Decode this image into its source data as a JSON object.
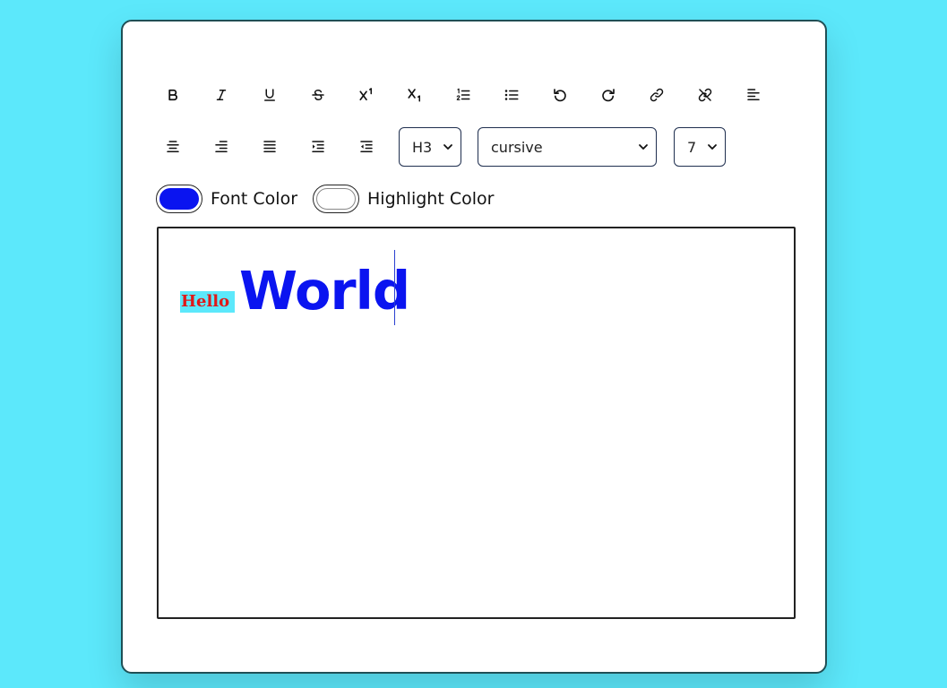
{
  "toolbar": {
    "row1": [
      {
        "name": "bold-button",
        "icon": "bold-icon"
      },
      {
        "name": "italic-button",
        "icon": "italic-icon"
      },
      {
        "name": "underline-button",
        "icon": "underline-icon"
      },
      {
        "name": "strikethrough-button",
        "icon": "strikethrough-icon"
      },
      {
        "name": "superscript-button",
        "icon": "superscript-icon"
      },
      {
        "name": "subscript-button",
        "icon": "subscript-icon"
      },
      {
        "name": "ordered-list-button",
        "icon": "ordered-list-icon"
      },
      {
        "name": "unordered-list-button",
        "icon": "unordered-list-icon"
      },
      {
        "name": "undo-button",
        "icon": "undo-icon"
      },
      {
        "name": "redo-button",
        "icon": "redo-icon"
      },
      {
        "name": "create-link-button",
        "icon": "link-icon"
      },
      {
        "name": "unlink-button",
        "icon": "unlink-icon"
      },
      {
        "name": "align-left-button",
        "icon": "align-left-icon"
      }
    ],
    "row2": [
      {
        "name": "align-center-button",
        "icon": "align-center-icon"
      },
      {
        "name": "align-right-button",
        "icon": "align-right-icon"
      },
      {
        "name": "justify-button",
        "icon": "justify-icon"
      },
      {
        "name": "indent-button",
        "icon": "indent-icon"
      },
      {
        "name": "outdent-button",
        "icon": "outdent-icon"
      }
    ],
    "heading_select": {
      "value": "H3"
    },
    "font_select": {
      "value": "cursive"
    },
    "size_select": {
      "value": "7"
    }
  },
  "colors": {
    "font_color": {
      "label": "Font Color",
      "value": "#0a14f0"
    },
    "highlight_color": {
      "label": "Highlight Color",
      "value": "#ffffff"
    }
  },
  "editor": {
    "segments": [
      {
        "text": "Hello",
        "color": "#e01818",
        "highlight": "#5ce8fb"
      },
      {
        "text": "World",
        "color": "#0a14f0"
      }
    ]
  },
  "theme": {
    "background": "#5ce8fb",
    "card_border": "#1f4f55"
  }
}
